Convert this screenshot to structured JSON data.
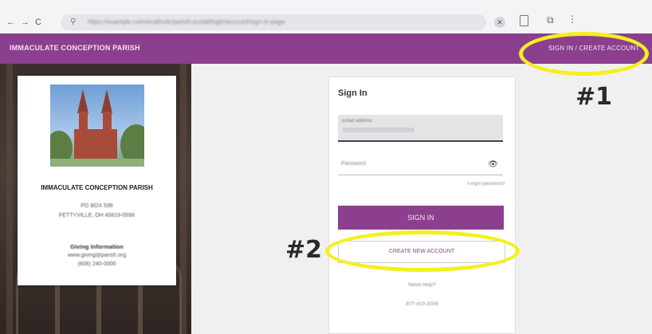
{
  "browser": {
    "nav_icons": [
      "←",
      "→",
      "C"
    ],
    "url": "https://example.com/ecatholic/parish-portal/login/account/sign-in-page",
    "close_glyph": "✕",
    "extensions_icon": "⧉",
    "menu_icon": "⋮"
  },
  "header": {
    "site_title": "IMMACULATE CONCEPTION PARISH",
    "signin_link": "SIGN IN / CREATE ACCOUNT",
    "color": "#8c3f8e"
  },
  "parish_card": {
    "name": "IMMACULATE CONCEPTION PARISH",
    "address_line1": "PO BOX 596",
    "address_line2": "FETTYVILLE, OH 45819-0596",
    "section_title": "Giving Information",
    "email": "www.giving@parish.org",
    "phone": "(608) 240-0000"
  },
  "signin": {
    "title": "Sign In",
    "username_label": "Email address",
    "password_label": "Password",
    "eye_icon": "👁",
    "forgot_link": "Forgot password?",
    "signin_button": "SIGN IN",
    "create_button": "CREATE NEW ACCOUNT",
    "need_help": "Need Help?",
    "help_phone": "877-410-2006"
  },
  "annotations": {
    "label1": "#1",
    "label2": "#2",
    "highlight_color": "#f3f01f"
  }
}
